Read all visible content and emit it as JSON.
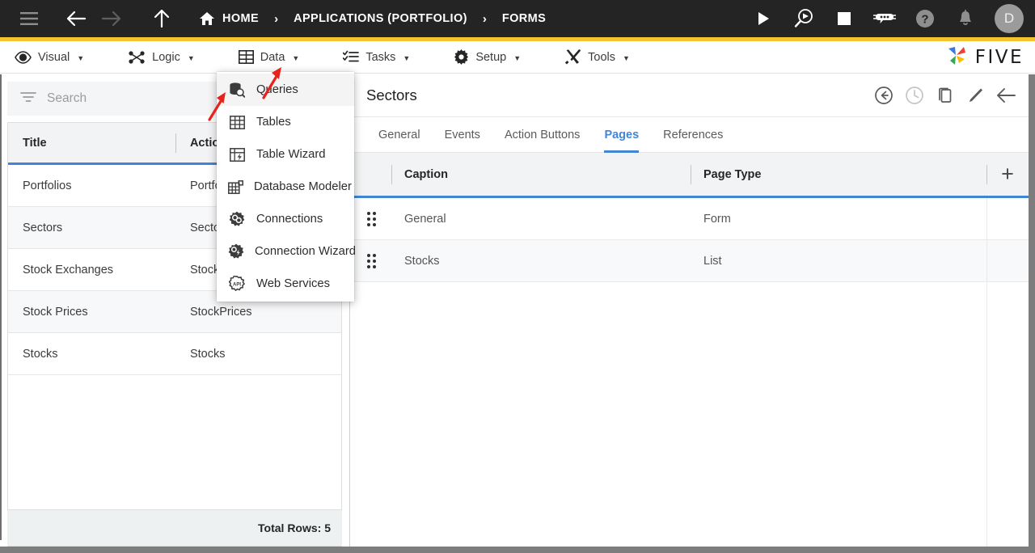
{
  "topbar": {
    "menu_icon": "hamburger-icon",
    "back_icon": "arrow-left-icon",
    "forward_icon": "arrow-right-icon",
    "up_icon": "arrow-up-icon",
    "home_icon": "home-icon",
    "breadcrumb": [
      {
        "label": "HOME",
        "has_home_icon": true
      },
      {
        "label": "APPLICATIONS (PORTFOLIO)",
        "has_home_icon": false
      },
      {
        "label": "FORMS",
        "has_home_icon": false
      }
    ],
    "separator": "›",
    "actions": [
      {
        "name": "run-icon",
        "title": "Run"
      },
      {
        "name": "debug-search-icon",
        "title": "Debug"
      },
      {
        "name": "stop-icon",
        "title": "Stop"
      },
      {
        "name": "chatbot-icon",
        "title": "Assistant"
      },
      {
        "name": "help-icon",
        "title": "Help"
      },
      {
        "name": "notifications-bell-icon",
        "title": "Notifications"
      }
    ],
    "avatar_initial": "D",
    "accent_color": "#f4c430",
    "background_color": "#242424"
  },
  "menubar": {
    "items": [
      {
        "label": "Visual",
        "icon": "eye-icon",
        "caret": "▼"
      },
      {
        "label": "Logic",
        "icon": "logic-nodes-icon",
        "caret": "▼"
      },
      {
        "label": "Data",
        "icon": "table-grid-icon",
        "caret": "▼"
      },
      {
        "label": "Tasks",
        "icon": "checklist-icon",
        "caret": "▼"
      },
      {
        "label": "Setup",
        "icon": "gear-icon",
        "caret": "▼"
      },
      {
        "label": "Tools",
        "icon": "tools-icon",
        "caret": "▼"
      }
    ],
    "brand": "FIVE"
  },
  "data_menu": {
    "items": [
      {
        "label": "Queries",
        "icon": "database-search-icon",
        "active": true
      },
      {
        "label": "Tables",
        "icon": "table-grid-icon",
        "active": false
      },
      {
        "label": "Table Wizard",
        "icon": "table-wizard-icon",
        "active": false
      },
      {
        "label": "Database Modeler",
        "icon": "database-modeler-icon",
        "active": false
      },
      {
        "label": "Connections",
        "icon": "connections-icon",
        "active": false
      },
      {
        "label": "Connection Wizard",
        "icon": "connection-wizard-icon",
        "active": false
      },
      {
        "label": "Web Services",
        "icon": "api-icon",
        "active": false
      }
    ]
  },
  "left_panel": {
    "search": {
      "placeholder": "Search",
      "value": "",
      "icon": "filter-icon"
    },
    "columns": [
      "Title",
      "Action"
    ],
    "rows": [
      {
        "title": "Portfolios",
        "action": "Portfolios"
      },
      {
        "title": "Sectors",
        "action": "Sectors"
      },
      {
        "title": "Stock Exchanges",
        "action": "StockExchanges"
      },
      {
        "title": "Stock Prices",
        "action": "StockPrices"
      },
      {
        "title": "Stocks",
        "action": "Stocks"
      }
    ],
    "footer": "Total Rows: 5"
  },
  "right_panel": {
    "title": "Sectors",
    "header_actions": [
      {
        "name": "revert-icon",
        "faint": false
      },
      {
        "name": "history-clock-icon",
        "faint": true
      },
      {
        "name": "copy-icon",
        "faint": false
      },
      {
        "name": "edit-pencil-icon",
        "faint": false
      },
      {
        "name": "back-arrow-icon",
        "faint": false
      }
    ],
    "tabs": [
      {
        "label": "General",
        "active": false
      },
      {
        "label": "Events",
        "active": false
      },
      {
        "label": "Action Buttons",
        "active": false
      },
      {
        "label": "Pages",
        "active": true
      },
      {
        "label": "References",
        "active": false
      }
    ],
    "table": {
      "columns": [
        "Caption",
        "Page Type"
      ],
      "add_button": "+",
      "rows": [
        {
          "caption": "General",
          "page_type": "Form"
        },
        {
          "caption": "Stocks",
          "page_type": "List"
        }
      ]
    }
  },
  "annotations": {
    "arrows": [
      {
        "name": "arrow-to-data-menu",
        "color": "#e8221c"
      },
      {
        "name": "arrow-to-queries-item",
        "color": "#e8221c"
      }
    ]
  }
}
